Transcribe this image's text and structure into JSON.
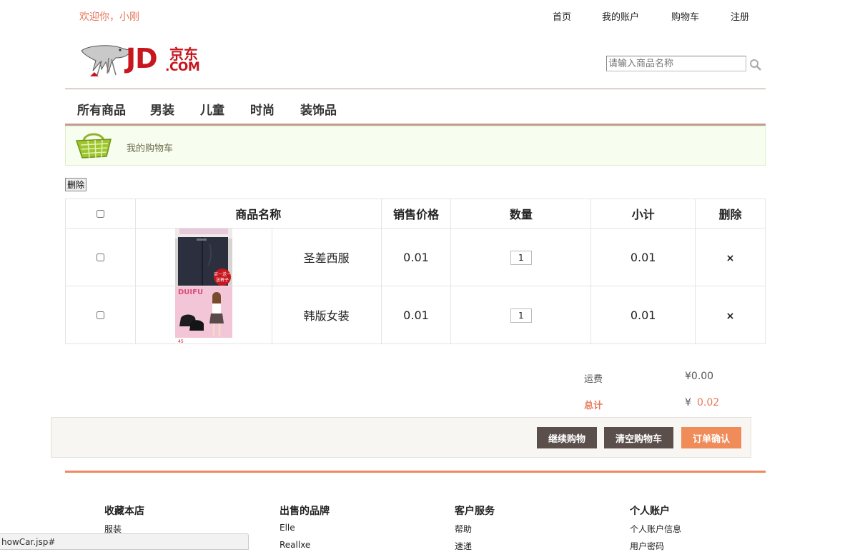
{
  "header": {
    "welcome": "欢迎你，小刚",
    "nav": [
      "首页",
      "我的账户",
      "购物车",
      "注册"
    ],
    "search_placeholder": "请输入商品名称"
  },
  "logo": {
    "latin": "JD",
    "cn": "京东",
    "com": ".COM"
  },
  "categories": [
    "所有商品",
    "男装",
    "儿童",
    "时尚",
    "装饰品"
  ],
  "banner": {
    "title": "我的购物车"
  },
  "delete_button": "删除",
  "table": {
    "headers": [
      "商品名称",
      "销售价格",
      "数量",
      "小计",
      "删除"
    ],
    "rows": [
      {
        "name": "圣差西服",
        "price": "0.01",
        "qty": "1",
        "subtotal": "0.01",
        "remove": "×"
      },
      {
        "name": "韩版女装",
        "price": "0.01",
        "qty": "1",
        "subtotal": "0.01",
        "remove": "×"
      }
    ],
    "thumb_texts": [
      "买一送一\n送裤子",
      "DUIFU",
      "45"
    ]
  },
  "totals": {
    "shipping_label": "运费",
    "shipping_value": "¥0.00",
    "total_label": "总计",
    "total_currency": "¥",
    "total_value": "0.02"
  },
  "actions": {
    "continue": "继续购物",
    "clear": "清空购物车",
    "confirm": "订单确认"
  },
  "footer": {
    "columns": [
      {
        "title": "收藏本店",
        "items": [
          "服装"
        ]
      },
      {
        "title": "出售的品牌",
        "items": [
          "Elle",
          "Reallxe"
        ]
      },
      {
        "title": "客户服务",
        "items": [
          "帮助",
          "速递"
        ]
      },
      {
        "title": "个人账户",
        "items": [
          "个人账户信息",
          "用户密码"
        ]
      }
    ]
  },
  "status_url": "howCar.jsp#",
  "colors": {
    "accent": "#f08b5a",
    "welcome": "#e8775a",
    "dark_button": "#5a4f4b",
    "logo_red": "#c8161e"
  }
}
